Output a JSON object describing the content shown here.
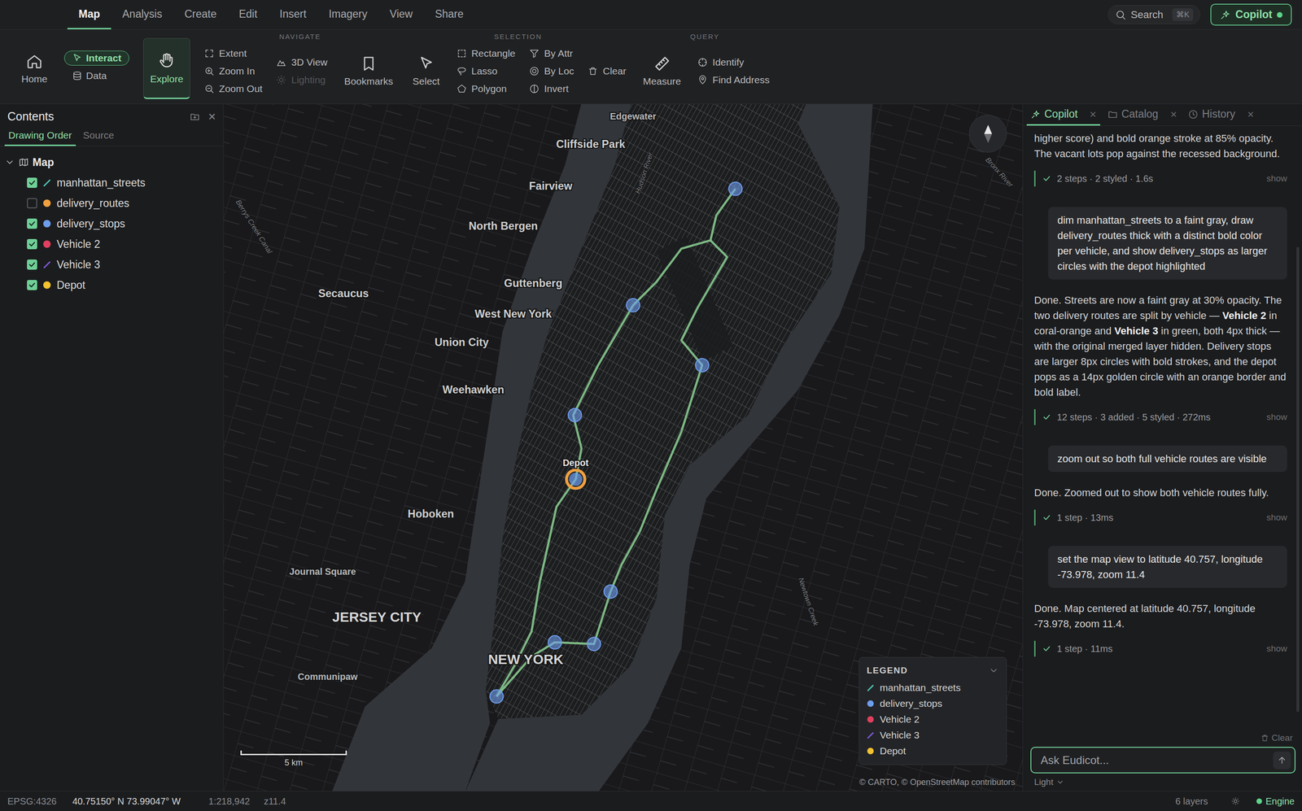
{
  "topbar": {
    "menu": [
      {
        "label": "Map",
        "selected": true
      },
      {
        "label": "Analysis",
        "selected": false
      },
      {
        "label": "Create",
        "selected": false
      },
      {
        "label": "Edit",
        "selected": false
      },
      {
        "label": "Insert",
        "selected": false
      },
      {
        "label": "Imagery",
        "selected": false
      },
      {
        "label": "View",
        "selected": false
      },
      {
        "label": "Share",
        "selected": false
      }
    ],
    "search": {
      "label": "Search",
      "shortcut": "⌘K"
    },
    "copilot": {
      "label": "Copilot",
      "online": true
    }
  },
  "ribbon": {
    "home": "Home",
    "modes": [
      {
        "label": "Interact",
        "selected": true
      },
      {
        "label": "Data",
        "selected": false
      }
    ],
    "explore": {
      "label": "Explore",
      "selected": true
    },
    "groups": [
      {
        "label": "NAVIGATE",
        "items": [
          {
            "kind": "stack",
            "buttons": [
              {
                "label": "Extent",
                "disabled": false
              },
              {
                "label": "Zoom In",
                "disabled": false
              },
              {
                "label": "Zoom Out",
                "disabled": false
              }
            ]
          },
          {
            "kind": "stack",
            "buttons": [
              {
                "label": "3D View",
                "disabled": false
              },
              {
                "label": "Lighting",
                "disabled": true
              }
            ]
          },
          {
            "kind": "big",
            "label": "Bookmarks"
          }
        ]
      },
      {
        "label": "SELECTION",
        "items": [
          {
            "kind": "big",
            "label": "Select"
          },
          {
            "kind": "stack",
            "buttons": [
              {
                "label": "Rectangle",
                "disabled": false
              },
              {
                "label": "Lasso",
                "disabled": false
              },
              {
                "label": "Polygon",
                "disabled": false
              }
            ]
          },
          {
            "kind": "stack",
            "buttons": [
              {
                "label": "By Attr",
                "disabled": false
              },
              {
                "label": "By Loc",
                "disabled": false
              },
              {
                "label": "Invert",
                "disabled": false
              }
            ]
          },
          {
            "kind": "stack",
            "buttons": [
              {
                "label": "Clear",
                "disabled": false
              }
            ]
          }
        ]
      },
      {
        "label": "QUERY",
        "items": [
          {
            "kind": "big",
            "label": "Measure"
          },
          {
            "kind": "stack",
            "buttons": [
              {
                "label": "Identify",
                "disabled": false
              },
              {
                "label": "Find Address",
                "disabled": false
              }
            ]
          }
        ]
      }
    ]
  },
  "contents": {
    "title": "Contents",
    "close": "×",
    "tabs": [
      {
        "label": "Drawing Order",
        "selected": true
      },
      {
        "label": "Source",
        "selected": false
      }
    ],
    "root": {
      "label": "Map",
      "expanded": true
    },
    "layers": [
      {
        "name": "manhattan_streets",
        "checked": true,
        "kind": "line",
        "color": "#4fc3b0"
      },
      {
        "name": "delivery_routes",
        "checked": false,
        "kind": "dot",
        "color": "#f0a040"
      },
      {
        "name": "delivery_stops",
        "checked": true,
        "kind": "dot",
        "color": "#6d9eeb"
      },
      {
        "name": "Vehicle 2",
        "checked": true,
        "kind": "dot",
        "color": "#e0405f"
      },
      {
        "name": "Vehicle 3",
        "checked": true,
        "kind": "line",
        "color": "#7f5ad6"
      },
      {
        "name": "Depot",
        "checked": true,
        "kind": "dot",
        "color": "#f2c230"
      }
    ]
  },
  "map": {
    "labels": [
      {
        "text": "Edgewater",
        "kind": "minor"
      },
      {
        "text": "Cliffside Park",
        "kind": "town"
      },
      {
        "text": "Fairview",
        "kind": "town"
      },
      {
        "text": "North Bergen",
        "kind": "town"
      },
      {
        "text": "Guttenberg",
        "kind": "town"
      },
      {
        "text": "Secaucus",
        "kind": "town"
      },
      {
        "text": "West New York",
        "kind": "town"
      },
      {
        "text": "Union City",
        "kind": "town"
      },
      {
        "text": "Weehawken",
        "kind": "town"
      },
      {
        "text": "Hoboken",
        "kind": "town"
      },
      {
        "text": "Journal Square",
        "kind": "minor"
      },
      {
        "text": "JERSEY CITY",
        "kind": "city"
      },
      {
        "text": "Communipaw",
        "kind": "minor"
      },
      {
        "text": "NEW YORK",
        "kind": "city"
      },
      {
        "text": "Hudson River",
        "kind": "water"
      },
      {
        "text": "Berrys Creek Canal",
        "kind": "water"
      },
      {
        "text": "Bronx River",
        "kind": "water"
      },
      {
        "text": "Newtown Creek",
        "kind": "water"
      }
    ],
    "routes": [
      {
        "color": "#86c98e"
      },
      {
        "color": "#86c98e"
      }
    ],
    "stops": {
      "color": "#6f9ff0"
    },
    "depot": {
      "label": "Depot",
      "color": "#f0a040"
    },
    "scale": "5 km",
    "attribution": "© CARTO, © OpenStreetMap contributors",
    "legend": {
      "title": "LEGEND",
      "expanded": true,
      "items": [
        {
          "label": "manhattan_streets",
          "kind": "line",
          "color": "#4fc3b0"
        },
        {
          "label": "delivery_stops",
          "kind": "dot",
          "color": "#6d9eeb"
        },
        {
          "label": "Vehicle 2",
          "kind": "dot",
          "color": "#e0405f"
        },
        {
          "label": "Vehicle 3",
          "kind": "line",
          "color": "#7f5ad6"
        },
        {
          "label": "Depot",
          "kind": "dot",
          "color": "#f2c230"
        }
      ]
    }
  },
  "copilot": {
    "tabs": [
      {
        "label": "Copilot",
        "selected": true,
        "close": "×"
      },
      {
        "label": "Catalog",
        "selected": false,
        "close": "×"
      },
      {
        "label": "History",
        "selected": false,
        "close": "×"
      }
    ],
    "chat": [
      {
        "kind": "assistant",
        "segments": [
          {
            "text": "higher score) and bold orange stroke at 85% opacity. The vacant lots pop against the recessed background.",
            "bold": false
          }
        ]
      },
      {
        "kind": "steps",
        "ok": true,
        "text": "2 steps · 2 styled · 1.6s",
        "action": "show"
      },
      {
        "kind": "user",
        "text": "dim manhattan_streets to a faint gray, draw delivery_routes thick with a distinct bold color per vehicle, and show delivery_stops as larger circles with the depot highlighted"
      },
      {
        "kind": "assistant",
        "segments": [
          {
            "text": "Done. Streets are now a faint gray at 30% opacity. The two delivery routes are split by vehicle — ",
            "bold": false
          },
          {
            "text": "Vehicle 2",
            "bold": true
          },
          {
            "text": " in coral-orange and ",
            "bold": false
          },
          {
            "text": "Vehicle 3",
            "bold": true
          },
          {
            "text": " in green, both 4px thick — with the original merged layer hidden. Delivery stops are larger 8px circles with bold strokes, and the depot pops as a 14px golden circle with an orange border and bold label.",
            "bold": false
          }
        ]
      },
      {
        "kind": "steps",
        "ok": true,
        "text": "12 steps · 3 added · 5 styled · 272ms",
        "action": "show"
      },
      {
        "kind": "user",
        "text": "zoom out so both full vehicle routes are visible"
      },
      {
        "kind": "assistant",
        "segments": [
          {
            "text": "Done. Zoomed out to show both vehicle routes fully.",
            "bold": false
          }
        ]
      },
      {
        "kind": "steps",
        "ok": true,
        "text": "1 step · 13ms",
        "action": "show"
      },
      {
        "kind": "user",
        "text": "set the map view to latitude 40.757, longitude -73.978, zoom 11.4"
      },
      {
        "kind": "assistant",
        "segments": [
          {
            "text": "Done. Map centered at latitude 40.757, longitude -73.978, zoom 11.4.",
            "bold": false
          }
        ]
      },
      {
        "kind": "steps",
        "ok": true,
        "text": "1 step · 11ms",
        "action": "show"
      }
    ],
    "clear": "Clear",
    "input": {
      "placeholder": "Ask Eudicot..."
    },
    "theme": "Light"
  },
  "status": {
    "crs": "EPSG:4326",
    "coords": "40.75150° N 73.99047° W",
    "scale": "1:218,942",
    "zoom": "z11.4",
    "layers": "6 layers",
    "engine": {
      "label": "Engine",
      "on": true
    }
  }
}
